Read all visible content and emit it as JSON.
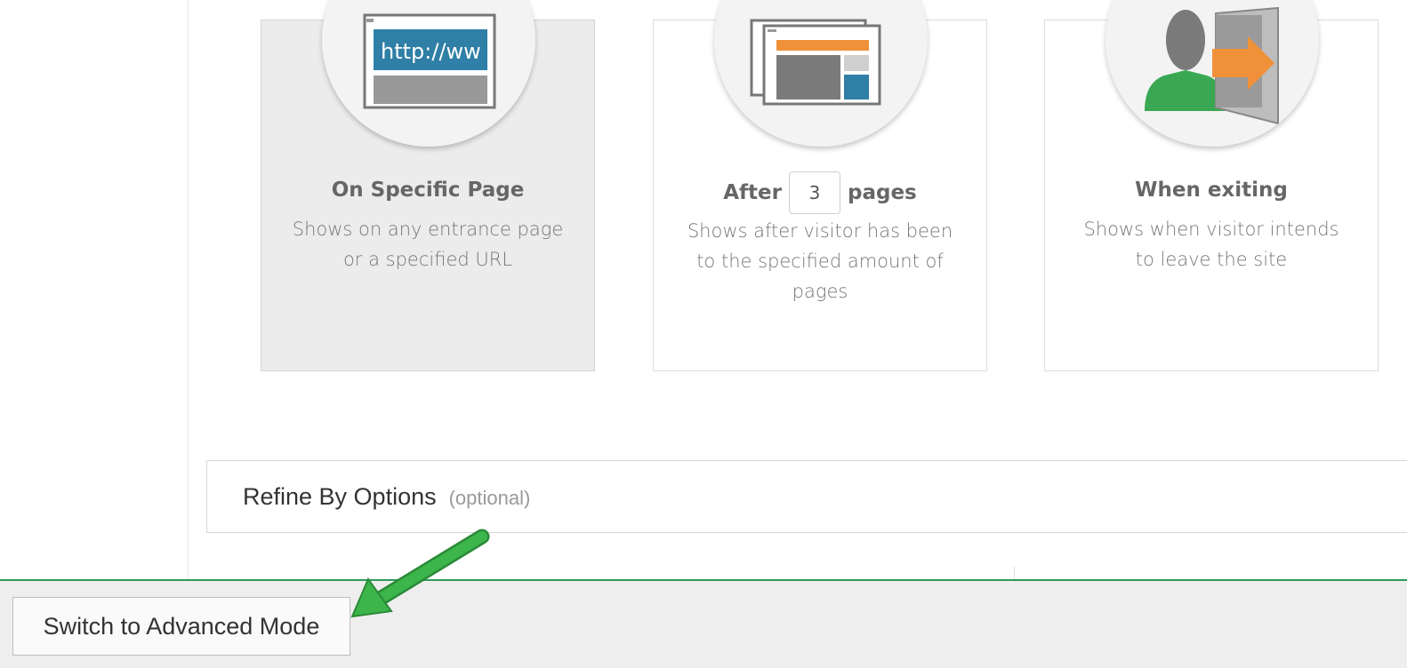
{
  "cards": [
    {
      "title": "On Specific Page",
      "description": "Shows on any entrance page or a specified URL",
      "illustration_text": "http://ww",
      "selected": true,
      "icon": "url-browser-icon"
    },
    {
      "title_before": "After",
      "title_after": "pages",
      "page_count": "3",
      "description": "Shows after visitor has been to the specified amount of pages",
      "selected": false,
      "icon": "browser-windows-icon"
    },
    {
      "title": "When exiting",
      "description": "Shows when visitor intends to leave the site",
      "selected": false,
      "icon": "exit-person-icon"
    }
  ],
  "refine": {
    "label": "Refine By Options",
    "optional": "(optional)"
  },
  "footer": {
    "advanced_button": "Switch to Advanced Mode"
  },
  "annotation": {
    "icon": "green-arrow-icon",
    "color": "#3cb54a"
  },
  "colors": {
    "accent_green": "#2e9a5a",
    "url_blue": "#2f7fa6",
    "orange": "#f0913a",
    "person_green": "#3aa853"
  }
}
